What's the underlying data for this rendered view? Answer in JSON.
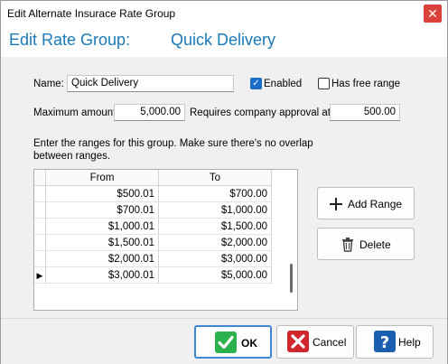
{
  "window": {
    "title": "Edit Alternate Insurace Rate Group",
    "close_glyph": "✕"
  },
  "header": {
    "heading": "Edit Rate Group:",
    "group_name": "Quick Delivery"
  },
  "form": {
    "name_label": "Name:",
    "name_value": "Quick Delivery",
    "enabled_label": "Enabled",
    "enabled_checked": true,
    "free_range_label": "Has free range",
    "free_range_checked": false,
    "max_amount_label": "Maximum amount:",
    "max_amount_value": "5,000.00",
    "approval_label": "Requires company approval at:",
    "approval_value": "500.00",
    "instructions": "Enter the ranges for this group. Make sure there's no overlap between ranges."
  },
  "grid": {
    "columns": [
      "From",
      "To"
    ],
    "rows": [
      {
        "from": "$500.01",
        "to": "$700.00",
        "indicator": ""
      },
      {
        "from": "$700.01",
        "to": "$1,000.00",
        "indicator": ""
      },
      {
        "from": "$1,000.01",
        "to": "$1,500.00",
        "indicator": ""
      },
      {
        "from": "$1,500.01",
        "to": "$2,000.00",
        "indicator": ""
      },
      {
        "from": "$2,000.01",
        "to": "$3,000.00",
        "indicator": ""
      },
      {
        "from": "$3,000.01",
        "to": "$5,000.00",
        "indicator": "▶"
      }
    ]
  },
  "buttons": {
    "add_range": "Add Range",
    "delete": "Delete",
    "ok": "OK",
    "cancel": "Cancel",
    "help": "Help"
  },
  "icons": {
    "add": "plus-icon",
    "delete": "trash-icon",
    "ok": "checkmark-icon",
    "cancel": "x-icon",
    "help": "question-icon"
  },
  "colors": {
    "heading": "#1a7ab8",
    "ok_icon": "#2bb24c",
    "cancel_icon": "#d0262d",
    "help_icon": "#1c5fb0",
    "checkbox": "#1e6ec8"
  }
}
